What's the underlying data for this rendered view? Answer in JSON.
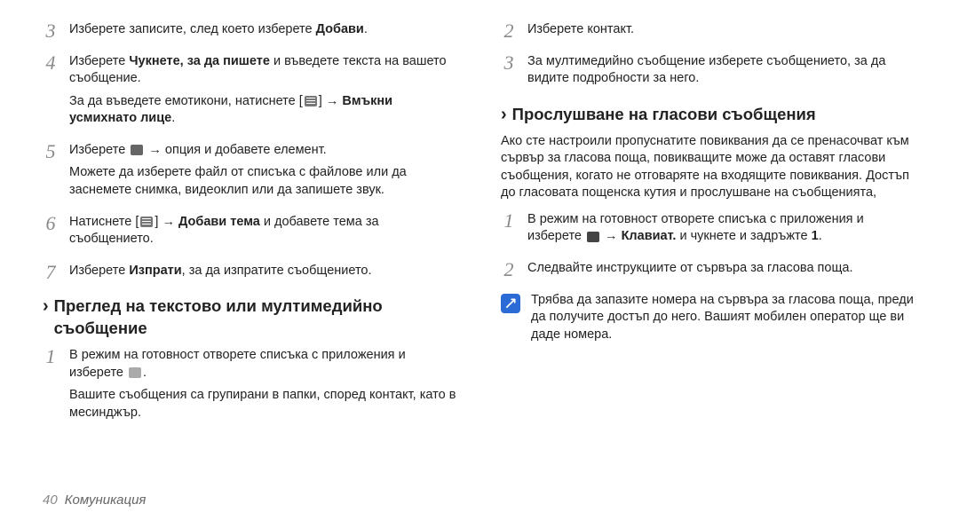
{
  "left": {
    "step3": {
      "t1a": "Изберете записите, след което изберете ",
      "t1b": "Добави",
      "t1c": "."
    },
    "step4": {
      "t1a": "Изберете ",
      "t1b": "Чукнете, за да пишете",
      "t1c": " и въведете текста на вашето съобщение.",
      "t2a": "За да въведете емотикони, натиснете [",
      "t2b": "] → ",
      "t2c": "Вмъкни усмихнато лице",
      "t2d": "."
    },
    "step5": {
      "t1a": "Изберете ",
      "t1b": " → опция и добавете елемент.",
      "t2": "Можете да изберете файл от списъка с файлове или да заснемете снимка, видеоклип или да запишете звук."
    },
    "step6": {
      "t1a": "Натиснете [",
      "t1b": "] → ",
      "t1c": "Добави тема",
      "t1d": " и добавете тема за съобщението."
    },
    "step7": {
      "t1a": "Изберете ",
      "t1b": "Изпрати",
      "t1c": ", за да изпратите съобщението."
    },
    "heading": "Преглед на текстово или мултимедийно съобщение",
    "step1": {
      "t1a": "В режим на готовност отворете списъка с приложения и изберете ",
      "t1b": ".",
      "t2": "Вашите съобщения са групирани в папки, според контакт, като в месинджър."
    }
  },
  "right": {
    "step2": {
      "t1": "Изберете контакт."
    },
    "step3": {
      "t1": "За мултимедийно съобщение изберете съобщението, за да видите подробности за него."
    },
    "heading": "Прослушване на гласови съобщения",
    "intro": "Ако сте настроили пропуснатите повиквания да се пренасочват към сървър за гласова поща, повикващите може да оставят гласови съобщения, когато не отговаряте на входящите повиквания. Достъп до гласовата пощенска кутия и прослушване на съобщенията,",
    "step1b": {
      "t1a": "В режим на готовност отворете списъка с приложения и изберете ",
      "t1b": " → ",
      "t1c": "Клавиат.",
      "t1d": " и чукнете и задръжте ",
      "t1e": "1",
      "t1f": "."
    },
    "step2b": {
      "t1": "Следвайте инструкциите от сървъра за гласова поща."
    },
    "note": "Трябва да запазите номера на сървъра за гласова поща, преди да получите достъп до него. Вашият мобилен оператор ще ви даде номера."
  },
  "footer": {
    "page": "40",
    "section": "Комуникация"
  }
}
